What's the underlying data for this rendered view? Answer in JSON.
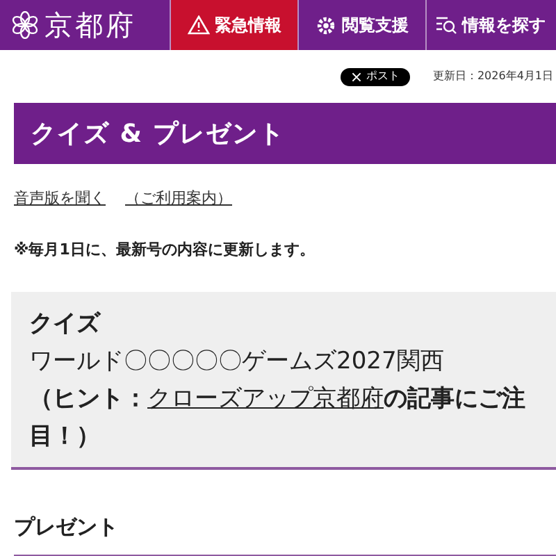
{
  "header": {
    "logo_text": "京都府",
    "nav": [
      {
        "label": "緊急情報",
        "kind": "alert"
      },
      {
        "label": "閲覧支援",
        "kind": "gear"
      },
      {
        "label": "情報を探す",
        "kind": "search"
      }
    ]
  },
  "share": {
    "post_button": "ポスト",
    "updated": "更新日：2026年4月1日"
  },
  "page_title": "クイズ & プレゼント",
  "links": [
    "音声版を聞く",
    "（ご利用案内）"
  ],
  "note": "※毎月1日に、最新号の内容に更新します。",
  "quiz": {
    "heading": "クイズ",
    "question": "ワールド〇〇〇〇〇ゲームズ2027関西",
    "hint_before": "（ヒント：",
    "hint_link": "クローズアップ京都府",
    "hint_after": "の記事にご注目！）"
  },
  "present": {
    "heading": "プレゼント"
  }
}
